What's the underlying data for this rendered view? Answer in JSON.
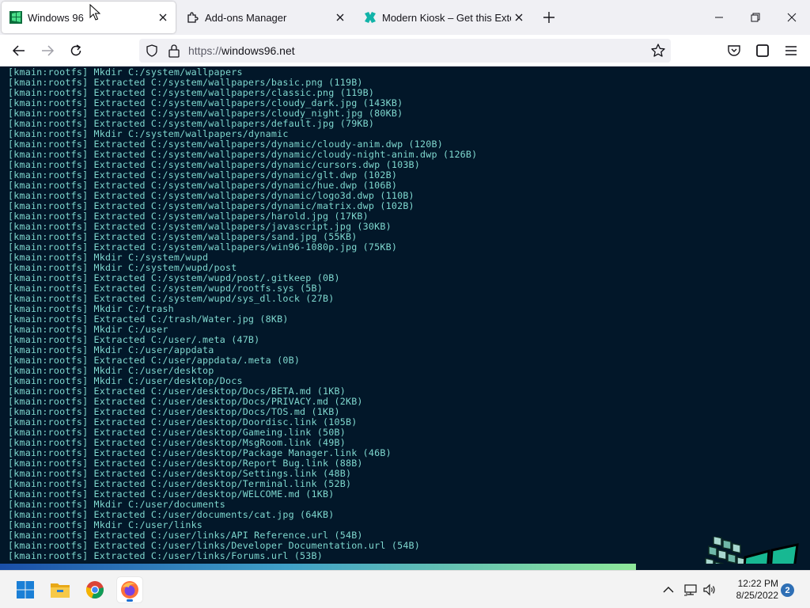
{
  "browser": {
    "tabs": [
      {
        "title": "Windows 96",
        "active": true
      },
      {
        "title": "Add-ons Manager",
        "active": false
      },
      {
        "title": "Modern Kiosk – Get this Extension",
        "active": false
      }
    ],
    "url_scheme": "https://",
    "url_host": "windows96.net"
  },
  "terminal": {
    "lines": [
      "[kmain:rootfs] Mkdir C:/system/wallpapers",
      "[kmain:rootfs] Extracted C:/system/wallpapers/basic.png (119B)",
      "[kmain:rootfs] Extracted C:/system/wallpapers/classic.png (119B)",
      "[kmain:rootfs] Extracted C:/system/wallpapers/cloudy_dark.jpg (143KB)",
      "[kmain:rootfs] Extracted C:/system/wallpapers/cloudy_night.jpg (80KB)",
      "[kmain:rootfs] Extracted C:/system/wallpapers/default.jpg (79KB)",
      "[kmain:rootfs] Mkdir C:/system/wallpapers/dynamic",
      "[kmain:rootfs] Extracted C:/system/wallpapers/dynamic/cloudy-anim.dwp (120B)",
      "[kmain:rootfs] Extracted C:/system/wallpapers/dynamic/cloudy-night-anim.dwp (126B)",
      "[kmain:rootfs] Extracted C:/system/wallpapers/dynamic/cursors.dwp (103B)",
      "[kmain:rootfs] Extracted C:/system/wallpapers/dynamic/glt.dwp (102B)",
      "[kmain:rootfs] Extracted C:/system/wallpapers/dynamic/hue.dwp (106B)",
      "[kmain:rootfs] Extracted C:/system/wallpapers/dynamic/logo3d.dwp (110B)",
      "[kmain:rootfs] Extracted C:/system/wallpapers/dynamic/matrix.dwp (102B)",
      "[kmain:rootfs] Extracted C:/system/wallpapers/harold.jpg (17KB)",
      "[kmain:rootfs] Extracted C:/system/wallpapers/javascript.jpg (30KB)",
      "[kmain:rootfs] Extracted C:/system/wallpapers/sand.jpg (55KB)",
      "[kmain:rootfs] Extracted C:/system/wallpapers/win96-1080p.jpg (75KB)",
      "[kmain:rootfs] Mkdir C:/system/wupd",
      "[kmain:rootfs] Mkdir C:/system/wupd/post",
      "[kmain:rootfs] Extracted C:/system/wupd/post/.gitkeep (0B)",
      "[kmain:rootfs] Extracted C:/system/wupd/rootfs.sys (5B)",
      "[kmain:rootfs] Extracted C:/system/wupd/sys_dl.lock (27B)",
      "[kmain:rootfs] Mkdir C:/trash",
      "[kmain:rootfs] Extracted C:/trash/Water.jpg (8KB)",
      "[kmain:rootfs] Mkdir C:/user",
      "[kmain:rootfs] Extracted C:/user/.meta (47B)",
      "[kmain:rootfs] Mkdir C:/user/appdata",
      "[kmain:rootfs] Extracted C:/user/appdata/.meta (0B)",
      "[kmain:rootfs] Mkdir C:/user/desktop",
      "[kmain:rootfs] Mkdir C:/user/desktop/Docs",
      "[kmain:rootfs] Extracted C:/user/desktop/Docs/BETA.md (1KB)",
      "[kmain:rootfs] Extracted C:/user/desktop/Docs/PRIVACY.md (2KB)",
      "[kmain:rootfs] Extracted C:/user/desktop/Docs/TOS.md (1KB)",
      "[kmain:rootfs] Extracted C:/user/desktop/Doordisc.link (105B)",
      "[kmain:rootfs] Extracted C:/user/desktop/Gameing.link (50B)",
      "[kmain:rootfs] Extracted C:/user/desktop/MsgRoom.link (49B)",
      "[kmain:rootfs] Extracted C:/user/desktop/Package Manager.link (46B)",
      "[kmain:rootfs] Extracted C:/user/desktop/Report Bug.link (88B)",
      "[kmain:rootfs] Extracted C:/user/desktop/Settings.link (48B)",
      "[kmain:rootfs] Extracted C:/user/desktop/Terminal.link (52B)",
      "[kmain:rootfs] Extracted C:/user/desktop/WELCOME.md (1KB)",
      "[kmain:rootfs] Mkdir C:/user/documents",
      "[kmain:rootfs] Extracted C:/user/documents/cat.jpg (64KB)",
      "[kmain:rootfs] Mkdir C:/user/links",
      "[kmain:rootfs] Extracted C:/user/links/API Reference.url (54B)",
      "[kmain:rootfs] Extracted C:/user/links/Developer Documentation.url (54B)",
      "[kmain:rootfs] Extracted C:/user/links/Forums.url (53B)"
    ],
    "progress_fraction": 0.785
  },
  "taskbar": {
    "pinned": [
      "windows-start-icon",
      "file-explorer-icon",
      "chrome-icon",
      "firefox-icon"
    ],
    "time": "12:22 PM",
    "date": "8/25/2022",
    "notification_count": "2"
  },
  "colors": {
    "terminal_bg": "#021729",
    "terminal_text": "#7fd8cf",
    "accent": "#1c6fd1"
  }
}
